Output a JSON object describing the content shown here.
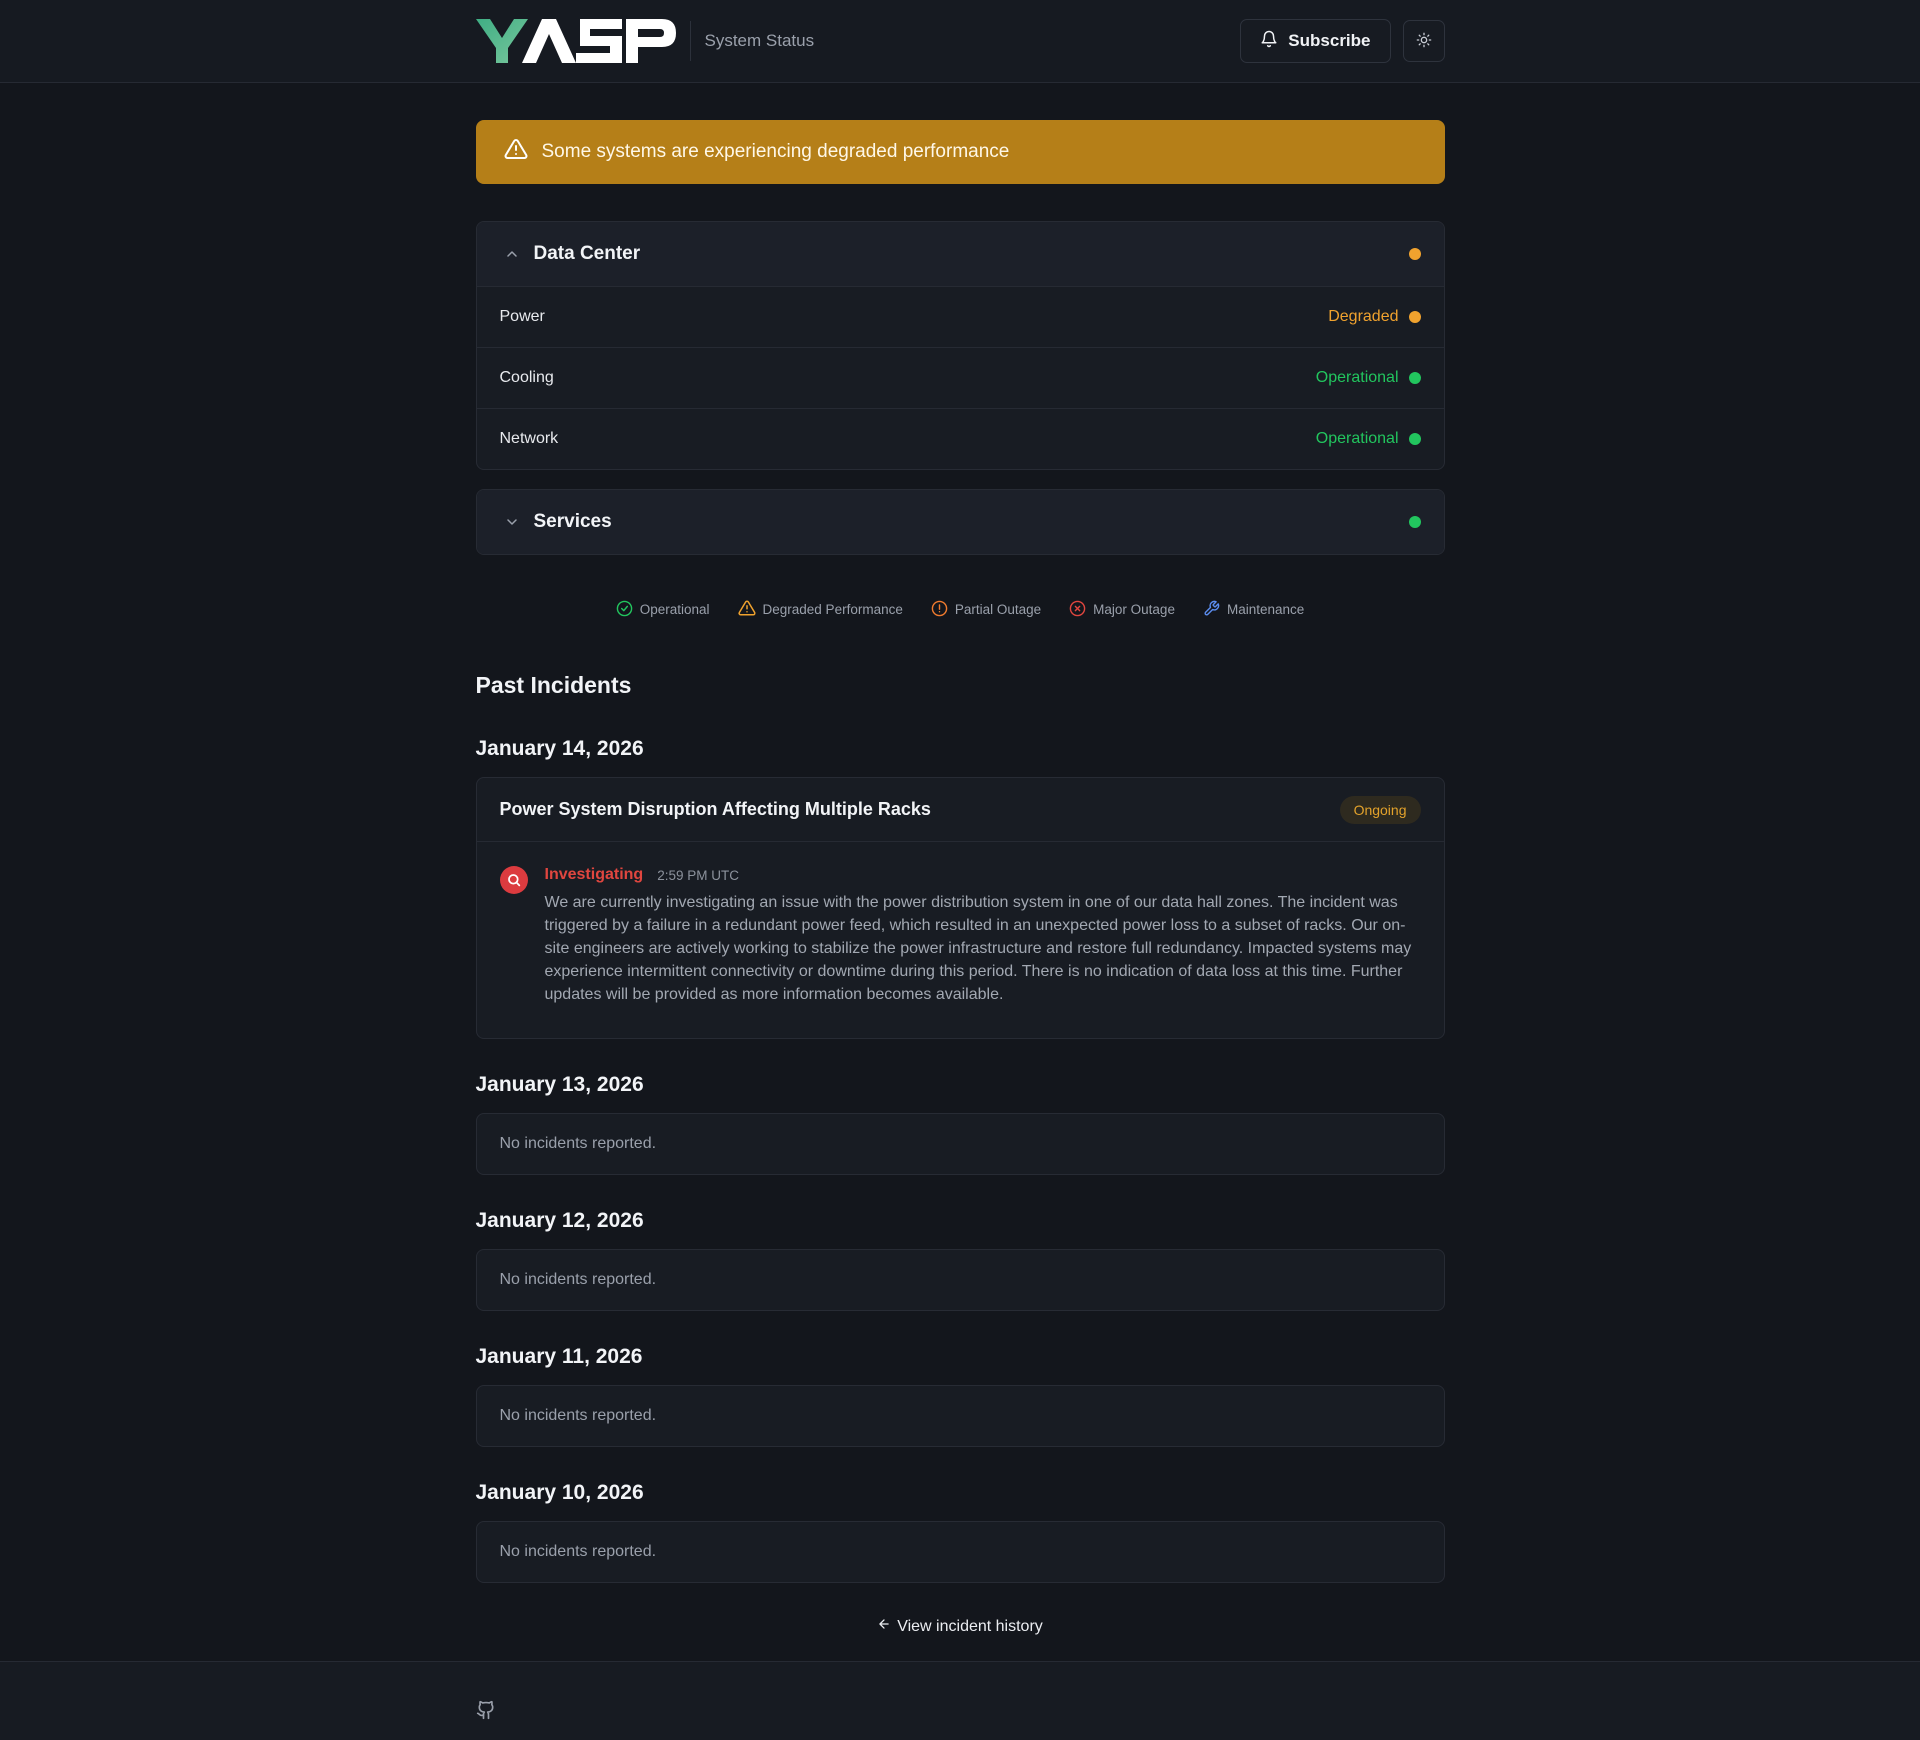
{
  "header": {
    "logo_text": "YASP",
    "subtitle": "System Status",
    "subscribe_label": "Subscribe"
  },
  "banner": {
    "message": "Some systems are experiencing degraded performance"
  },
  "groups": [
    {
      "title": "Data Center",
      "expanded": true,
      "status_color": "#f0a22e",
      "components": [
        {
          "name": "Power",
          "status": "Degraded",
          "color": "#f0a22e"
        },
        {
          "name": "Cooling",
          "status": "Operational",
          "color": "#22c55e"
        },
        {
          "name": "Network",
          "status": "Operational",
          "color": "#22c55e"
        }
      ]
    },
    {
      "title": "Services",
      "expanded": false,
      "status_color": "#22c55e"
    }
  ],
  "legend": [
    {
      "label": "Operational",
      "icon": "check-circle-icon",
      "color": "#22c55e"
    },
    {
      "label": "Degraded Performance",
      "icon": "warning-triangle-icon",
      "color": "#f0a22e"
    },
    {
      "label": "Partial Outage",
      "icon": "alert-circle-icon",
      "color": "#f07b2e"
    },
    {
      "label": "Major Outage",
      "icon": "x-circle-icon",
      "color": "#e0463f"
    },
    {
      "label": "Maintenance",
      "icon": "wrench-icon",
      "color": "#5b8def"
    }
  ],
  "past_incidents": {
    "title": "Past Incidents",
    "days": [
      {
        "date": "January 14, 2026",
        "incident": {
          "title": "Power System Disruption Affecting Multiple Racks",
          "badge": "Ongoing",
          "update": {
            "status": "Investigating",
            "time": "2:59 PM UTC",
            "text": "We are currently investigating an issue with the power distribution system in one of our data hall zones. The incident was triggered by a failure in a redundant power feed, which resulted in an unexpected power loss to a subset of racks. Our on-site engineers are actively working to stabilize the power infrastructure and restore full redundancy. Impacted systems may experience intermittent connectivity or downtime during this period. There is no indication of data loss at this time. Further updates will be provided as more information becomes available."
          }
        }
      },
      {
        "date": "January 13, 2026",
        "empty": "No incidents reported."
      },
      {
        "date": "January 12, 2026",
        "empty": "No incidents reported."
      },
      {
        "date": "January 11, 2026",
        "empty": "No incidents reported."
      },
      {
        "date": "January 10, 2026",
        "empty": "No incidents reported."
      }
    ],
    "history_link": "View incident history"
  }
}
